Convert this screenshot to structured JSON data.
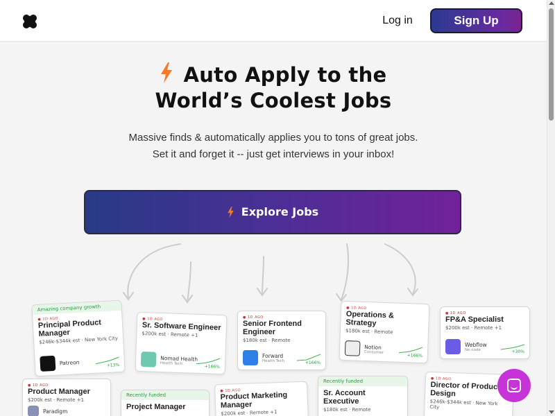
{
  "header": {
    "login_label": "Log in",
    "signup_label": "Sign Up"
  },
  "hero": {
    "title_line1": "Auto Apply to the",
    "title_line2": "World’s Coolest Jobs",
    "subtitle_line1": "Massive finds & automatically applies you to tons of great jobs.",
    "subtitle_line2": "Set it and forget it -- just get interviews in your inbox!",
    "cta_label": "Explore Jobs"
  },
  "colors": {
    "accent_start": "#283a86",
    "accent_end": "#72219a",
    "bolt": "#f47a2a",
    "chat": "#c633d6"
  },
  "cards": [
    {
      "tag": "● 1D AGO",
      "band": "Amazing company growth",
      "title": "Principal Product Manager",
      "meta": "$246k-$344k est · New York City",
      "company": "Patreon",
      "company_sub": "",
      "growth": "+13%"
    },
    {
      "tag": "● 1D AGO",
      "band": "",
      "title": "Sr. Software Engineer",
      "meta": "$200k est · Remote +1",
      "company": "Nomad Health",
      "company_sub": "Health Tech",
      "growth": "+166%"
    },
    {
      "tag": "● 1D AGO",
      "band": "",
      "title": "Senior Frontend Engineer",
      "meta": "$180k est · Remote",
      "company": "Forward",
      "company_sub": "Health Tech",
      "growth": "+166%"
    },
    {
      "tag": "● 1D AGO",
      "band": "",
      "title": "Operations & Strategy",
      "meta": "$180k est · Remote",
      "company": "Notion",
      "company_sub": "Consumer",
      "growth": "+166%"
    },
    {
      "tag": "● 1D AGO",
      "band": "",
      "title": "FP&A Specialist",
      "meta": "$200k est · Remote +1",
      "company": "Webflow",
      "company_sub": "No-code",
      "growth": "+30%"
    },
    {
      "tag": "● 1D AGO",
      "band": "",
      "title": "Product Manager",
      "meta": "$200k est · Remote +1",
      "company": "Paradigm",
      "company_sub": "",
      "growth": ""
    },
    {
      "tag": "",
      "band": "Recently funded",
      "title": "Project Manager",
      "meta": "",
      "company": "",
      "company_sub": "",
      "growth": ""
    },
    {
      "tag": "● 1D AGO",
      "band": "",
      "title": "Product Marketing Manager",
      "meta": "$200k est · Remote +1",
      "company": "",
      "company_sub": "",
      "growth": ""
    },
    {
      "tag": "",
      "band": "Recently funded",
      "title": "Sr. Account Executive",
      "meta": "$180k est · Remote",
      "company": "",
      "company_sub": "",
      "growth": ""
    },
    {
      "tag": "● 1D AGO",
      "band": "",
      "title": "Director of Product Design",
      "meta": "$246k-$344k est · New York City",
      "company": "",
      "company_sub": "",
      "growth": ""
    }
  ]
}
